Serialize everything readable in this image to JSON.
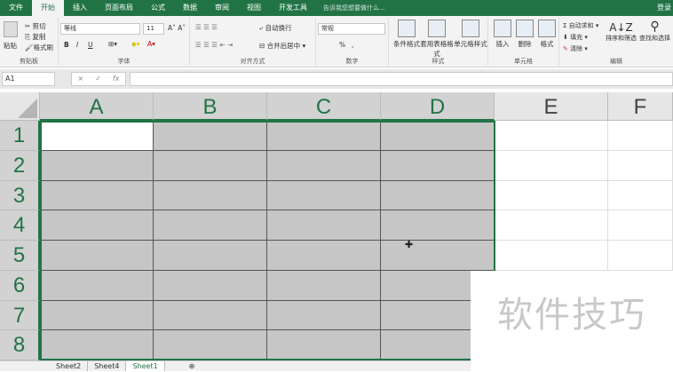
{
  "tabs": [
    "文件",
    "开始",
    "插入",
    "页面布局",
    "公式",
    "数据",
    "审阅",
    "视图",
    "开发工具"
  ],
  "active_tab": "开始",
  "tell_me": "告诉我您想要做什么...",
  "login": "登录",
  "clipboard": {
    "paste": "粘贴",
    "cut": "剪切",
    "copy": "复制",
    "format_painter": "格式刷",
    "label": "剪贴板"
  },
  "font": {
    "name": "等线",
    "size": "11",
    "bold": "B",
    "italic": "I",
    "underline": "U",
    "label": "字体"
  },
  "alignment": {
    "wrap": "自动换行",
    "merge": "合并后居中",
    "label": "对齐方式"
  },
  "number": {
    "format": "常规",
    "percent": "%",
    "comma": ",",
    "label": "数字"
  },
  "styles": {
    "conditional": "条件格式",
    "table": "套用表格格式",
    "cell": "单元格样式",
    "label": "样式"
  },
  "cells": {
    "insert": "插入",
    "delete": "删除",
    "format": "格式",
    "label": "单元格"
  },
  "editing": {
    "autosum": "自动求和",
    "fill": "填充",
    "clear": "清除",
    "sort": "排序和筛选",
    "find": "查找和选择",
    "label": "编辑"
  },
  "formula_bar": {
    "name_box": "A1",
    "cancel": "×",
    "enter": "✓",
    "fx": "fx",
    "value": ""
  },
  "columns": [
    "A",
    "B",
    "C",
    "D",
    "E",
    "F"
  ],
  "rows": [
    "1",
    "2",
    "3",
    "4",
    "5",
    "6",
    "7",
    "8"
  ],
  "sheets": [
    "Sheet2",
    "Sheet4",
    "Sheet1"
  ],
  "active_sheet": "Sheet1",
  "add_sheet": "⊕",
  "watermark": "软件技巧"
}
